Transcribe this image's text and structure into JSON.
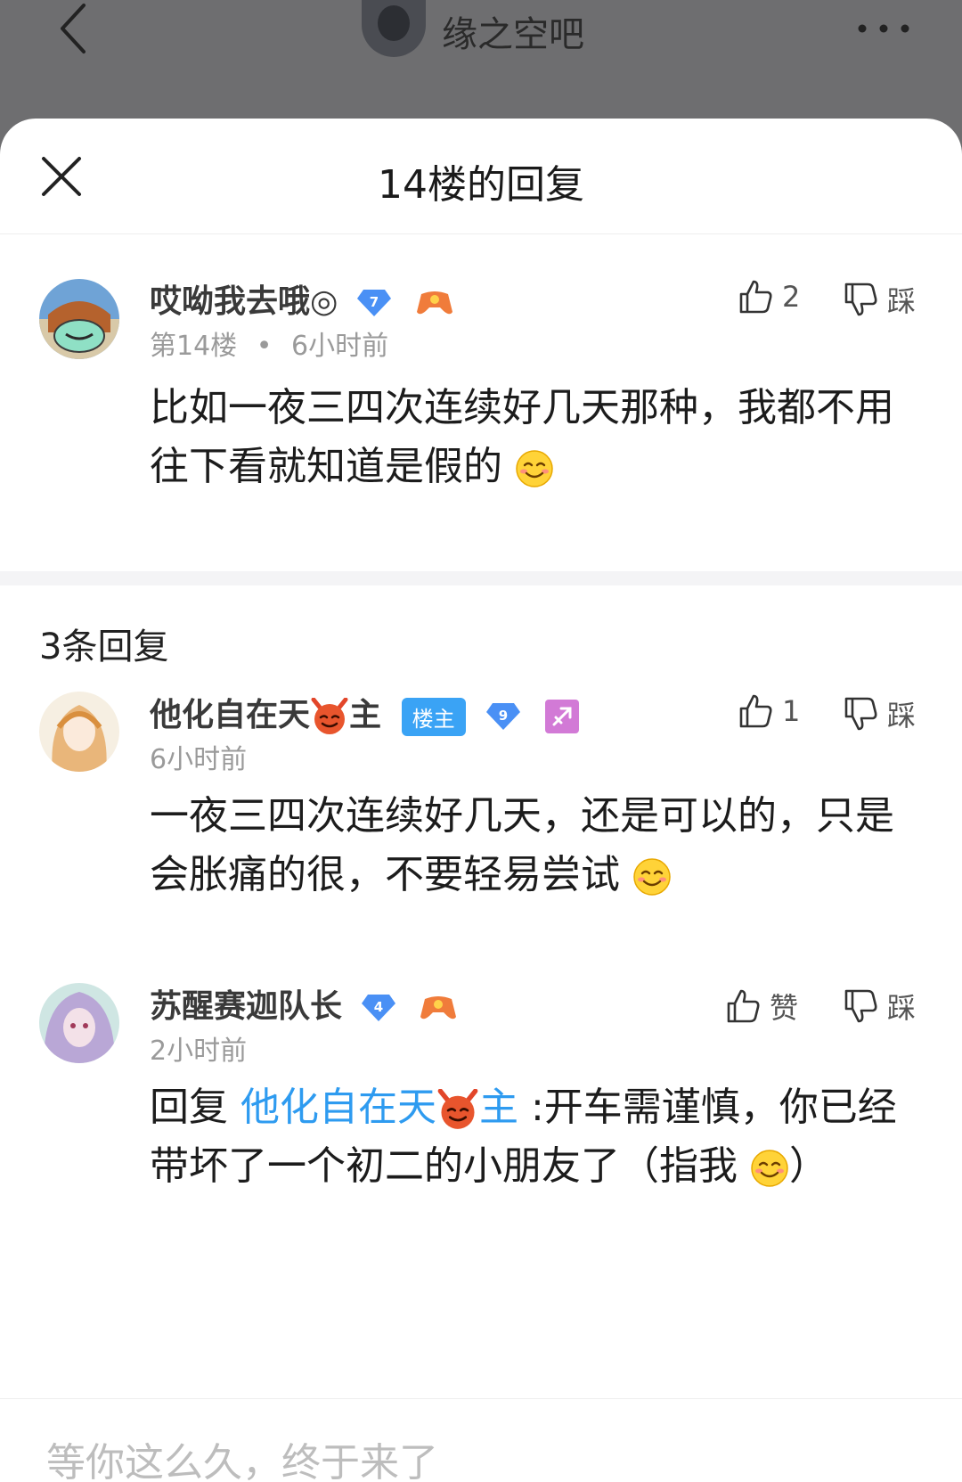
{
  "topbar": {
    "forum_name": "缘之空吧",
    "back_icon": "chevron-left-icon",
    "more_icon": "more-dots-icon"
  },
  "sheet": {
    "title": "14楼的回复",
    "close_icon": "close-icon"
  },
  "main_post": {
    "username": "哎呦我去哦◎",
    "level": "7",
    "floor": "第14楼",
    "separator": "•",
    "time": "6小时前",
    "like_count": "2",
    "dislike_label": "踩",
    "text": "比如一夜三四次连续好几天那种，我都不用往下看就知道是假的"
  },
  "replies_header": "3条回复",
  "replies": [
    {
      "username_text": "他化自在天",
      "username_suffix": "主",
      "owner_tag": "楼主",
      "level": "9",
      "time": "6小时前",
      "like_count": "1",
      "dislike_label": "踩",
      "text": "一夜三四次连续好几天，还是可以的，只是会胀痛的很，不要轻易尝试"
    },
    {
      "username_text": "苏醒赛迦队长",
      "level": "4",
      "time": "2小时前",
      "like_label": "赞",
      "dislike_label": "踩",
      "reply_prefix": "回复 ",
      "reply_target": "他化自在天",
      "reply_target_suffix": "主",
      "text": " :开车需谨慎，你已经带坏了一个初二的小朋友了（指我",
      "text_end": "）"
    }
  ],
  "composer": {
    "placeholder": "等你这么久，终于来了"
  },
  "colors": {
    "accent_link": "#2e9bf0",
    "owner_tag": "#3aa3f5",
    "level_badge": "#4a90f5"
  }
}
